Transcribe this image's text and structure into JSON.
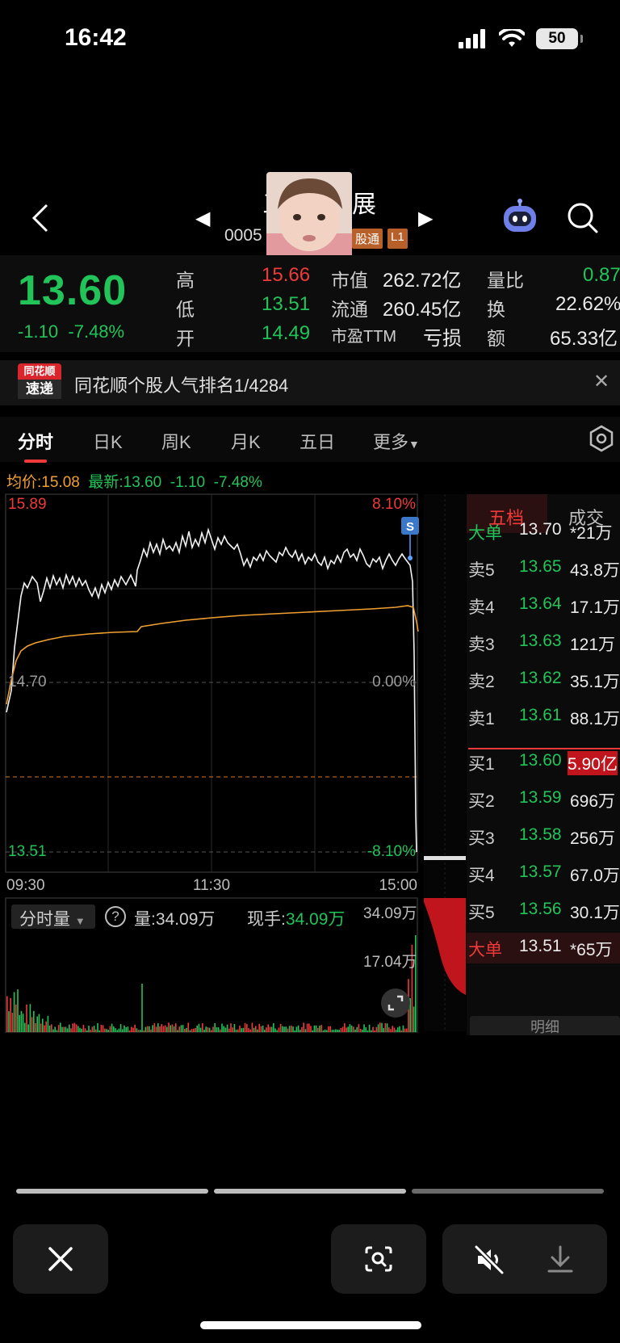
{
  "status": {
    "time": "16:42",
    "battery": "50"
  },
  "header": {
    "name_left": "三",
    "name_right": "展",
    "code": "0005",
    "badge1": "股通",
    "badge2": "L1"
  },
  "quote": {
    "price": "13.60",
    "change": "-1.10",
    "change_pct": "-7.48%",
    "high_label": "高",
    "high": "15.66",
    "low_label": "低",
    "low": "13.51",
    "open_label": "开",
    "open": "14.49",
    "mktcap_label": "市值",
    "mktcap": "262.72亿",
    "float_label": "流通",
    "float": "260.45亿",
    "pe_label": "市盈TTM",
    "pe": "亏损",
    "vol_ratio_label": "量比",
    "vol_ratio": "0.87",
    "turnover_label": "换",
    "turnover": "22.62%",
    "amount_label": "额",
    "amount": "65.33亿"
  },
  "ranking": {
    "logo_top": "同花顺",
    "logo_bottom": "速递",
    "text": "同花顺个股人气排名1/4284"
  },
  "tabs": [
    "分时",
    "日K",
    "周K",
    "月K",
    "五日",
    "更多"
  ],
  "intraday": {
    "avg_label": "均价:",
    "avg": "15.08",
    "latest_label": "最新:",
    "latest": "13.60",
    "change": "-1.10",
    "change_pct": "-7.48%",
    "price_high": "15.89",
    "pct_high": "8.10%",
    "price_mid": "14.70",
    "pct_mid": "0.00%",
    "price_low": "13.51",
    "pct_low": "-8.10%",
    "t_start": "09:30",
    "t_mid": "11:30",
    "t_end": "15:00",
    "sell_marker": "S"
  },
  "volume": {
    "selector": "分时量",
    "vol_label": "量:",
    "vol": "34.09万",
    "hand_label": "现手:",
    "hand": "34.09万",
    "axis_max": "34.09万",
    "axis_mid": "17.04万"
  },
  "orderbook": {
    "tab_active": "五档",
    "tab_other": "成交",
    "detail": "明细",
    "rows": [
      {
        "label": "大单",
        "price": "13.70",
        "vol": "*21万",
        "kind": "big-top"
      },
      {
        "label": "卖5",
        "price": "13.65",
        "vol": "43.8万",
        "kind": "sell"
      },
      {
        "label": "卖4",
        "price": "13.64",
        "vol": "17.1万",
        "kind": "sell"
      },
      {
        "label": "卖3",
        "price": "13.63",
        "vol": "121万",
        "kind": "sell"
      },
      {
        "label": "卖2",
        "price": "13.62",
        "vol": "35.1万",
        "kind": "sell"
      },
      {
        "label": "卖1",
        "price": "13.61",
        "vol": "88.1万",
        "kind": "sell"
      },
      {
        "label": "买1",
        "price": "13.60",
        "vol": "5.90亿",
        "kind": "buy1"
      },
      {
        "label": "买2",
        "price": "13.59",
        "vol": "696万",
        "kind": "buy"
      },
      {
        "label": "买3",
        "price": "13.58",
        "vol": "256万",
        "kind": "buy"
      },
      {
        "label": "买4",
        "price": "13.57",
        "vol": "67.0万",
        "kind": "buy"
      },
      {
        "label": "买5",
        "price": "13.56",
        "vol": "30.1万",
        "kind": "buy"
      },
      {
        "label": "大单",
        "price": "13.51",
        "vol": "*65万",
        "kind": "big-bottom"
      }
    ]
  },
  "colors": {
    "up": "#f03a3a",
    "down": "#22c45a",
    "avg": "#f0a030",
    "bg": "#000000"
  }
}
